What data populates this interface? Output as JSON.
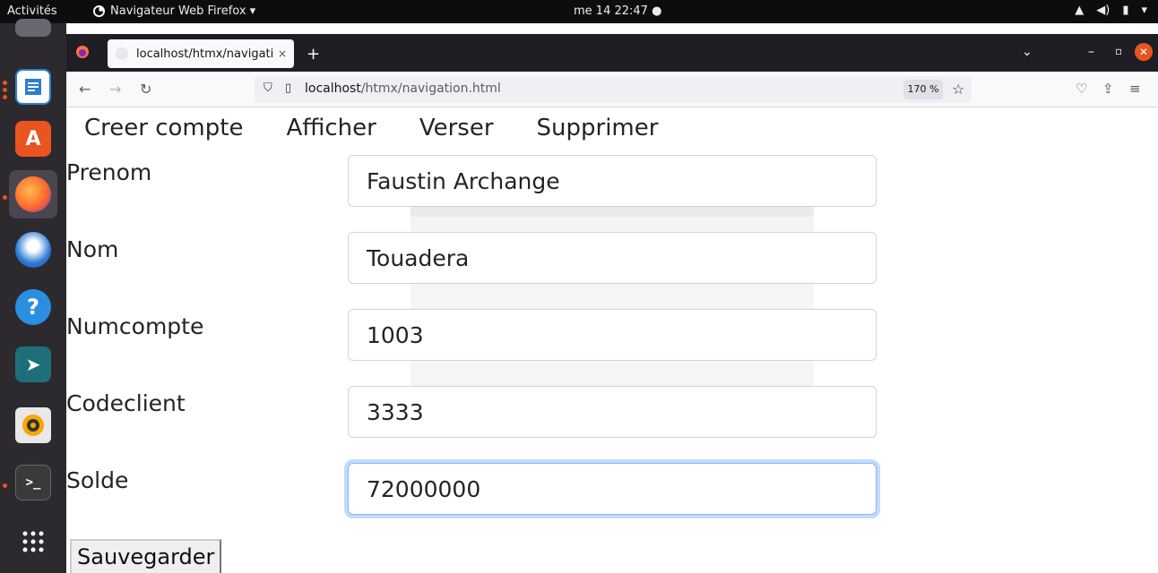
{
  "topbar": {
    "activities": "Activités",
    "app_name": "Navigateur Web Firefox ▾",
    "clock": "me 14  22:47  ●"
  },
  "browser": {
    "tab_title": "localhost/htmx/navigation.h",
    "tab_close": "×",
    "new_tab": "+",
    "url_host": "localhost",
    "url_path": "/htmx/navigation.html",
    "zoom": "170 %"
  },
  "page": {
    "menu": [
      "Creer compte",
      "Afficher",
      "Verser",
      "Supprimer"
    ],
    "fields": [
      {
        "label": "Prenom",
        "value": "Faustin Archange"
      },
      {
        "label": "Nom",
        "value": "Touadera"
      },
      {
        "label": "Numcompte",
        "value": "1003"
      },
      {
        "label": "Codeclient",
        "value": "3333"
      },
      {
        "label": "Solde",
        "value": "72000000"
      }
    ],
    "save_label": "Sauvegarder"
  },
  "colors": {
    "accent": "#e95420",
    "focus_ring": "#86b7fe"
  }
}
